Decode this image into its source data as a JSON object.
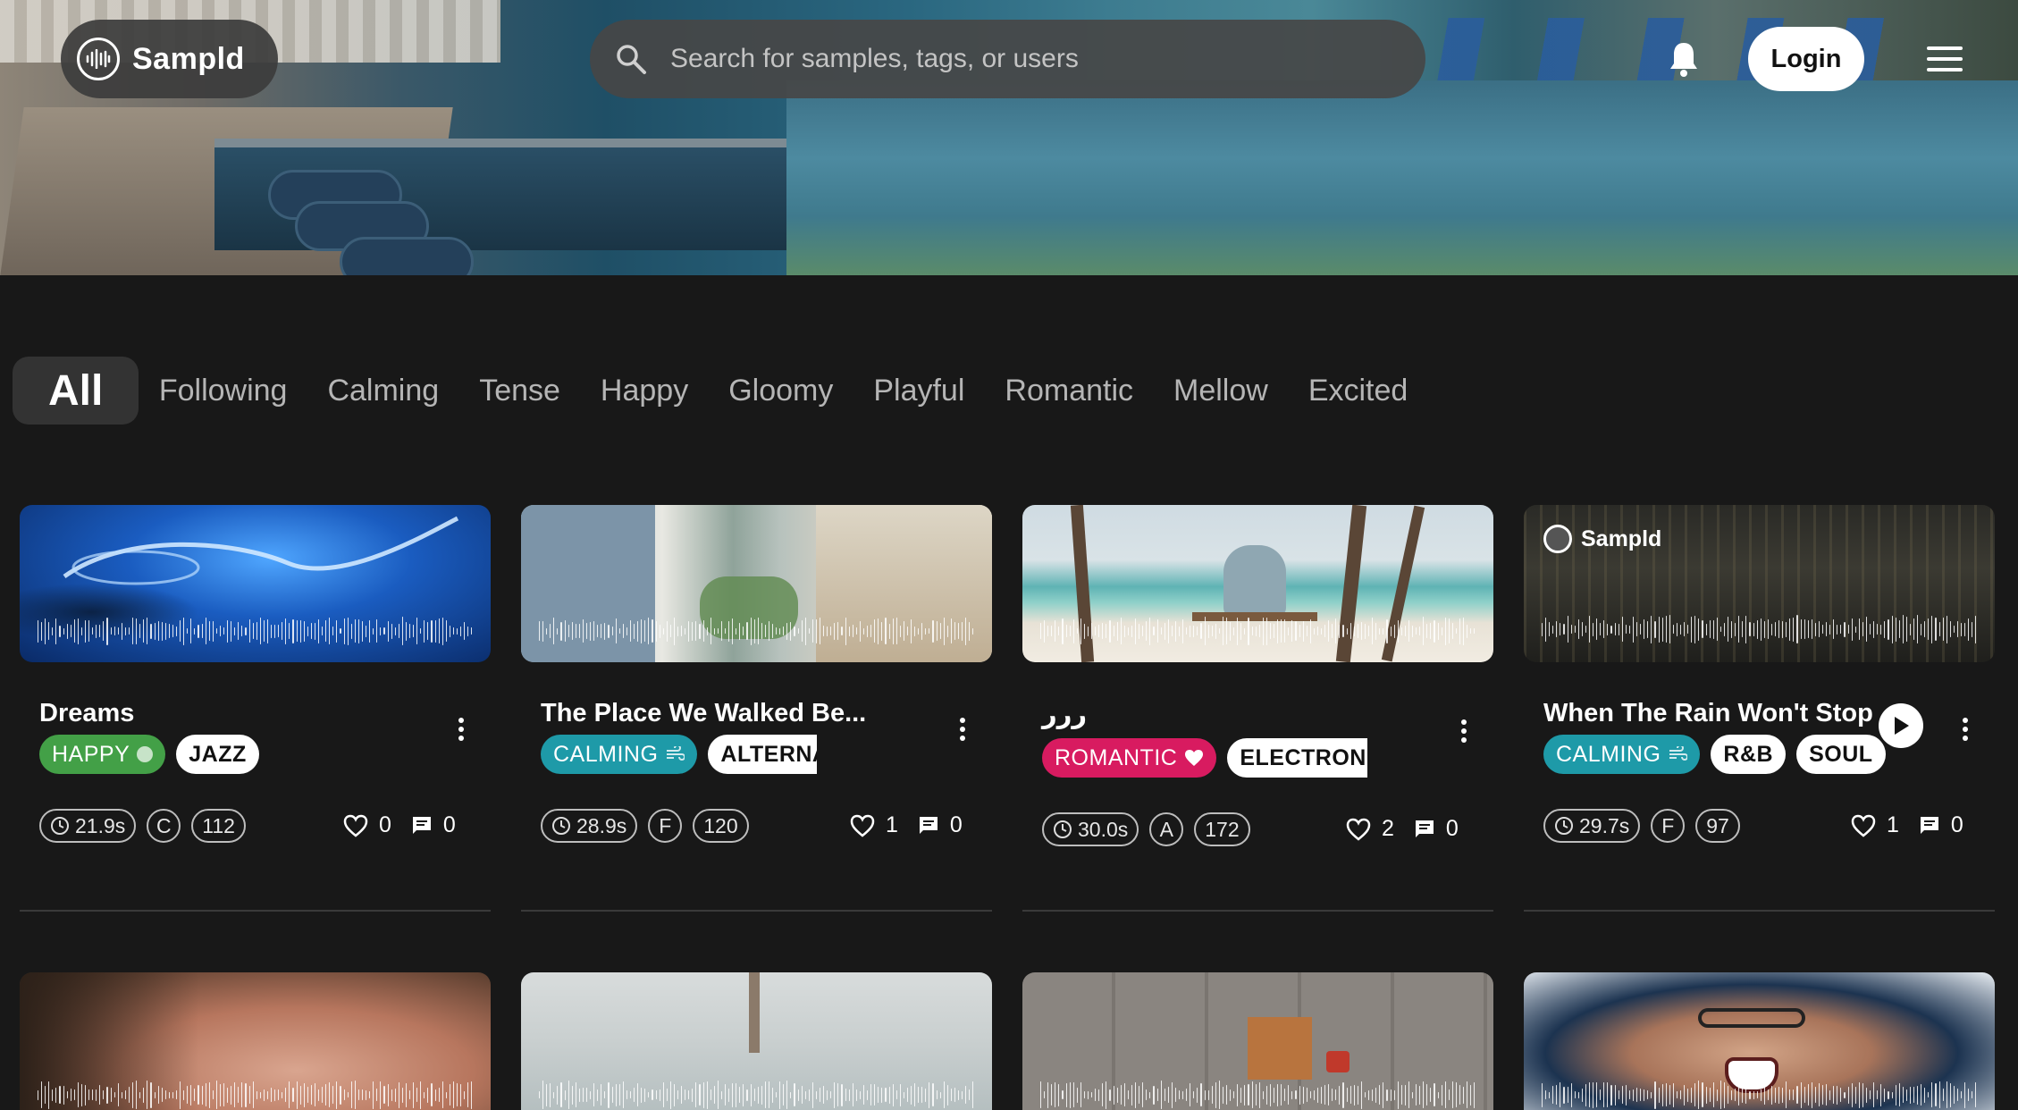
{
  "app": {
    "name": "Sampld"
  },
  "search": {
    "placeholder": "Search for samples, tags, or users"
  },
  "header": {
    "login_label": "Login"
  },
  "tabs": [
    "All",
    "Following",
    "Calming",
    "Tense",
    "Happy",
    "Gloomy",
    "Playful",
    "Romantic",
    "Mellow",
    "Excited"
  ],
  "active_tab": "All",
  "colors": {
    "happy": "#43a047",
    "calming": "#1e9aa8",
    "romantic": "#d81b60",
    "background": "#181818"
  },
  "cards": [
    {
      "title": "Dreams",
      "mood": {
        "label": "HAPPY",
        "icon": "circle-icon"
      },
      "genres": [
        "JAZZ"
      ],
      "duration": "21.9s",
      "key": "C",
      "bpm": "112",
      "likes": "0",
      "comments": "0"
    },
    {
      "title": "The Place We Walked Be...",
      "mood": {
        "label": "CALMING",
        "icon": "wind-icon"
      },
      "genres": [
        "ALTERNATIVE"
      ],
      "duration": "28.9s",
      "key": "F",
      "bpm": "120",
      "likes": "1",
      "comments": "0"
    },
    {
      "title": "ررر",
      "mood": {
        "label": "ROMANTIC",
        "icon": "heart-icon"
      },
      "genres": [
        "ELECTRONIC"
      ],
      "duration": "30.0s",
      "key": "A",
      "bpm": "172",
      "likes": "2",
      "comments": "0"
    },
    {
      "title": "When The Rain Won't Stop",
      "badge": "Sampld",
      "mood": {
        "label": "CALMING",
        "icon": "wind-icon"
      },
      "genres": [
        "R&B",
        "SOUL"
      ],
      "duration": "29.7s",
      "key": "F",
      "bpm": "97",
      "likes": "1",
      "comments": "0"
    }
  ]
}
